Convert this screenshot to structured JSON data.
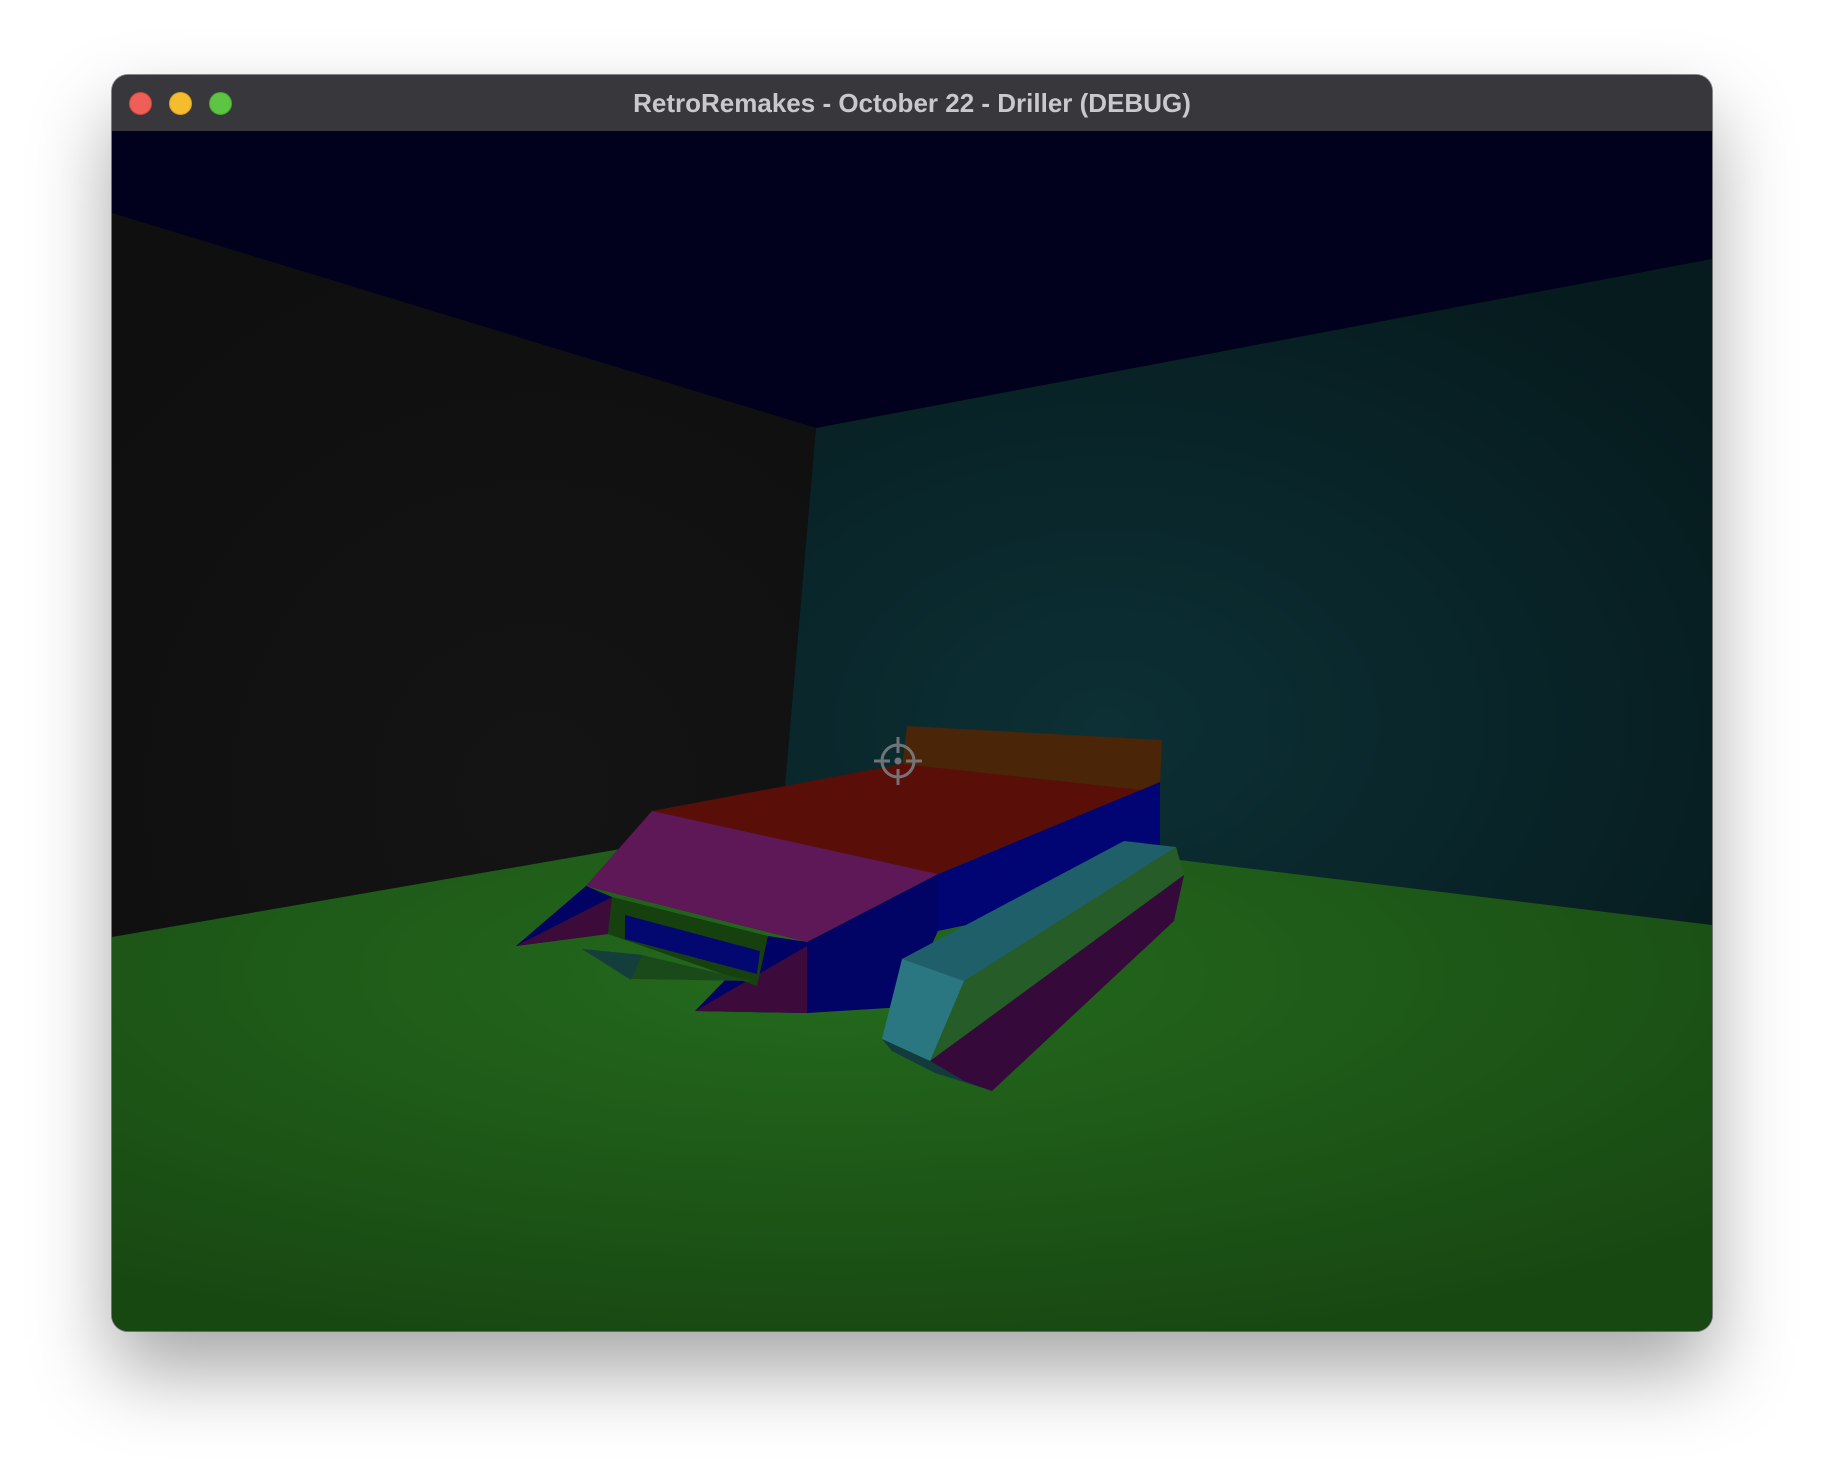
{
  "window": {
    "title": "RetroRemakes - October 22 - Driller (DEBUG)",
    "controls": [
      "close",
      "minimize",
      "zoom"
    ]
  },
  "game": {
    "scene": "3D room with tank-like vehicle",
    "crosshair_icon": "crosshair-icon",
    "colors": {
      "ceiling": "#01011d",
      "left_wall": "#121212",
      "right_wall": "#0a2a2f",
      "floor": "#1f5a1a",
      "vehicle_top_red": "#5a0e08",
      "vehicle_top_purple": "#5e1757",
      "vehicle_side_blue": "#010573",
      "vehicle_rear_orange": "#4a2507",
      "track_teal": "#1e6068",
      "track_purple": "#35093a"
    }
  }
}
